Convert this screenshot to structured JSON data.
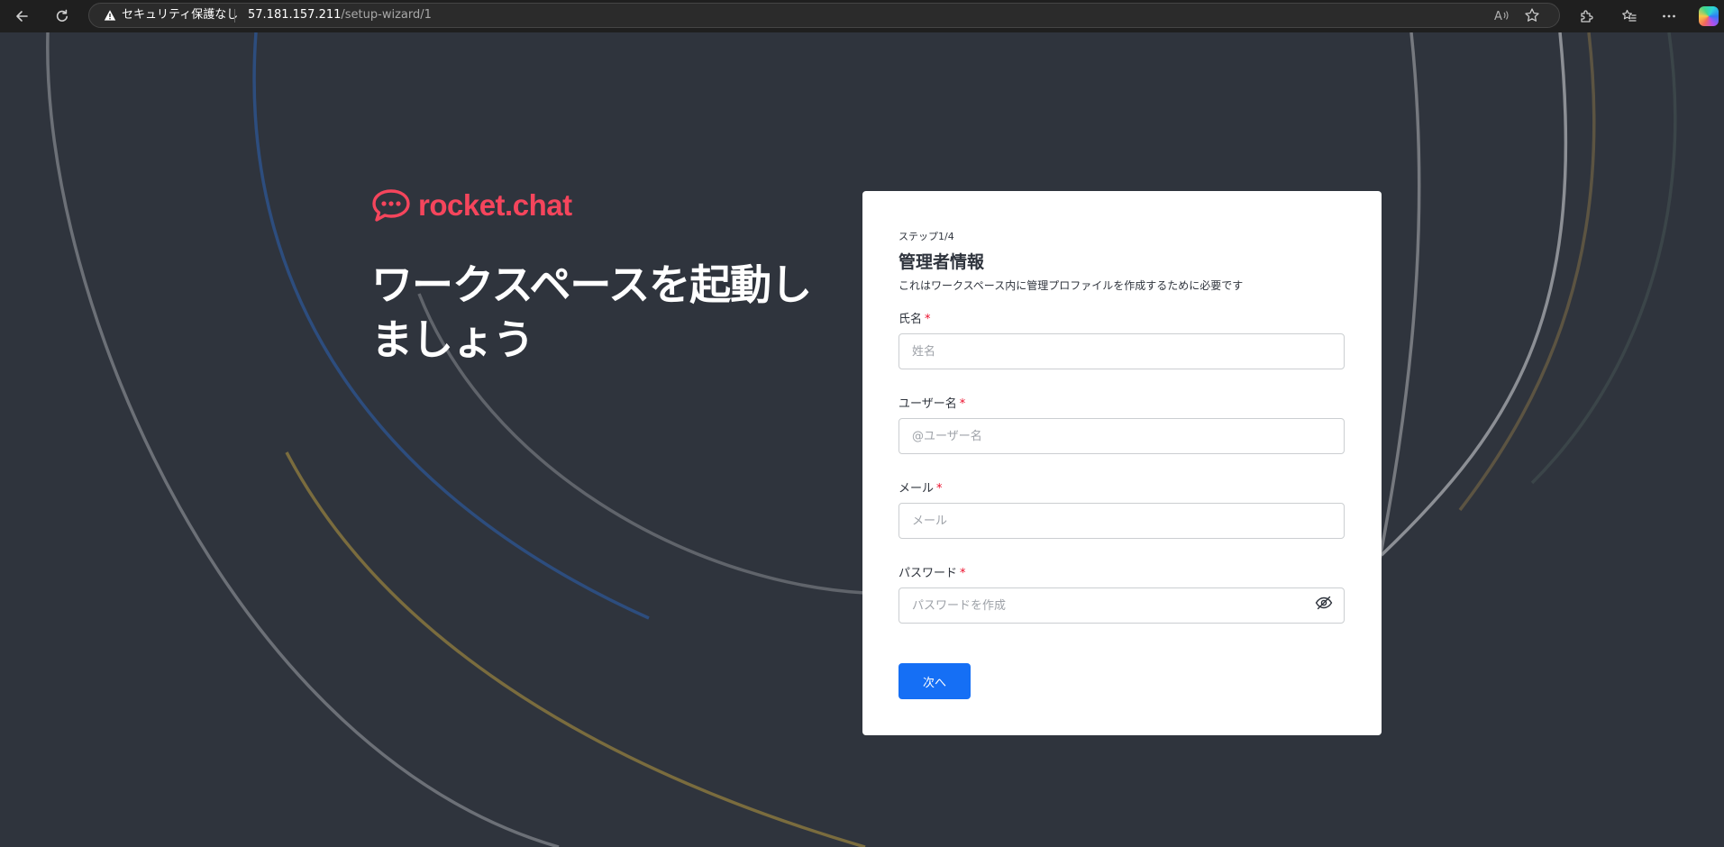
{
  "browser": {
    "security_label": "セキュリティ保護なし",
    "url_host": "57.181.157.211",
    "url_path": "/setup-wizard/1",
    "icons": [
      "back-icon",
      "reload-icon",
      "warning-icon",
      "read-aloud-icon",
      "favorite-star-icon",
      "extensions-icon",
      "favorites-list-icon",
      "more-icon",
      "copilot-icon"
    ]
  },
  "brand": {
    "logo_text": "rocket.chat",
    "color": "#f5455c"
  },
  "hero": {
    "title": "ワークスペースを起動しましょう"
  },
  "wizard": {
    "step": "ステップ1/4",
    "title": "管理者情報",
    "description": "これはワークスペース内に管理プロファイルを作成するために必要です",
    "fields": [
      {
        "label": "氏名",
        "required": "*",
        "placeholder": "姓名",
        "value": ""
      },
      {
        "label": "ユーザー名",
        "required": "*",
        "placeholder": "@ユーザー名",
        "value": ""
      },
      {
        "label": "メール",
        "required": "*",
        "placeholder": "メール",
        "value": ""
      },
      {
        "label": "パスワード",
        "required": "*",
        "placeholder": "パスワードを作成",
        "value": ""
      }
    ],
    "next_label": "次へ",
    "accent": "#156ff5",
    "required_color": "#ec0d2a"
  },
  "colors": {
    "page_background": "#2f343d",
    "card_background": "#ffffff"
  }
}
